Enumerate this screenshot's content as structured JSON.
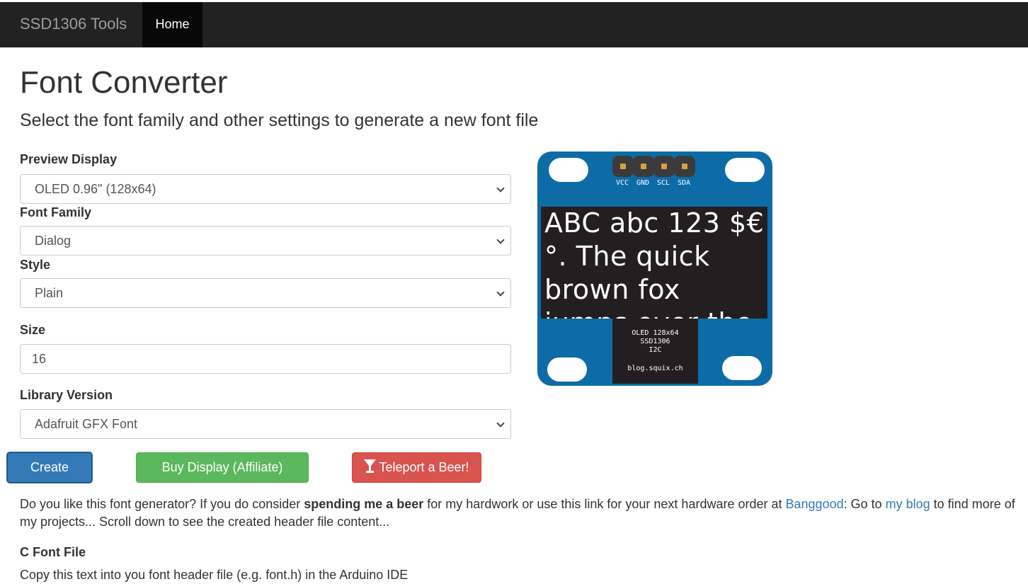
{
  "navbar": {
    "brand": "SSD1306 Tools",
    "home_label": "Home"
  },
  "page": {
    "title": "Font Converter",
    "subtitle": "Select the font family and other settings to generate a new font file"
  },
  "form": {
    "preview_display": {
      "label": "Preview Display",
      "value": "OLED 0.96\" (128x64)"
    },
    "font_family": {
      "label": "Font Family",
      "value": "Dialog"
    },
    "style": {
      "label": "Style",
      "value": "Plain"
    },
    "size": {
      "label": "Size",
      "value": "16"
    },
    "library_version": {
      "label": "Library Version",
      "value": "Adafruit GFX Font"
    }
  },
  "buttons": {
    "create": "Create",
    "buy": "Buy Display (Affiliate)",
    "beer": "Teleport a Beer!",
    "beer_icon": "cocktail-glass-icon"
  },
  "preview": {
    "pins": [
      "VCC",
      "GND",
      "SCL",
      "SDA"
    ],
    "screen_text": "ABC abc 123 $€°. The quick brown fox jumps over the",
    "chip_line1": "OLED 128x64",
    "chip_line2": "SSD1306",
    "chip_line3": "I2C",
    "chip_site": "blog.squix.ch",
    "board_color": "#0d6ca6",
    "pin_color": "#d9a042"
  },
  "info": {
    "text1": "Do you like this font generator? If you do consider ",
    "bold": "spending me a beer",
    "text2": " for my hardwork or use this link for your next hardware order at ",
    "link1": "Banggood",
    "text3": ": Go to ",
    "link2": "my blog",
    "text4": " to find more of my projects... Scroll down to see the created header file content..."
  },
  "output": {
    "title": "C Font File",
    "description": "Copy this text into you font header file (e.g. font.h) in the Arduino IDE"
  },
  "colors": {
    "navbar": "#222222",
    "primary": "#337ab7",
    "success": "#5cb85c",
    "danger": "#d9534f"
  }
}
